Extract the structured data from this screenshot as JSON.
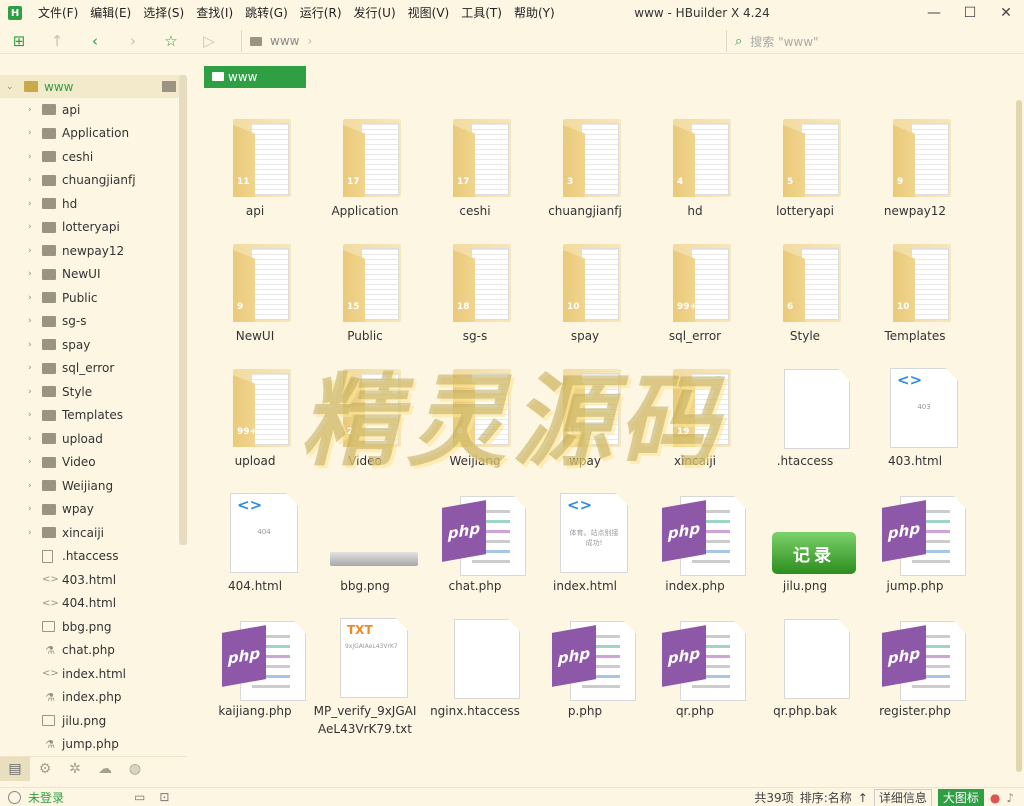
{
  "app": {
    "title": "www - HBuilder X 4.24",
    "logo": "H"
  },
  "menu": [
    "文件(F)",
    "编辑(E)",
    "选择(S)",
    "查找(I)",
    "跳转(G)",
    "运行(R)",
    "发行(U)",
    "视图(V)",
    "工具(T)",
    "帮助(Y)"
  ],
  "window_controls": {
    "minimize": "—",
    "maximize": "☐",
    "close": "✕"
  },
  "toolbar": {
    "breadcrumb": "www",
    "search_placeholder": "搜索 \"www\""
  },
  "tree": {
    "root": "www",
    "items": [
      {
        "name": "api",
        "kind": "folder"
      },
      {
        "name": "Application",
        "kind": "folder"
      },
      {
        "name": "ceshi",
        "kind": "folder"
      },
      {
        "name": "chuangjianfj",
        "kind": "folder"
      },
      {
        "name": "hd",
        "kind": "folder"
      },
      {
        "name": "lotteryapi",
        "kind": "folder"
      },
      {
        "name": "newpay12",
        "kind": "folder"
      },
      {
        "name": "NewUI",
        "kind": "folder"
      },
      {
        "name": "Public",
        "kind": "folder"
      },
      {
        "name": "sg-s",
        "kind": "folder"
      },
      {
        "name": "spay",
        "kind": "folder"
      },
      {
        "name": "sql_error",
        "kind": "folder"
      },
      {
        "name": "Style",
        "kind": "folder"
      },
      {
        "name": "Templates",
        "kind": "folder"
      },
      {
        "name": "upload",
        "kind": "folder"
      },
      {
        "name": "Video",
        "kind": "folder"
      },
      {
        "name": "Weijiang",
        "kind": "folder"
      },
      {
        "name": "wpay",
        "kind": "folder"
      },
      {
        "name": "xincaiji",
        "kind": "folder"
      },
      {
        "name": ".htaccess",
        "kind": "file"
      },
      {
        "name": "403.html",
        "kind": "html"
      },
      {
        "name": "404.html",
        "kind": "html"
      },
      {
        "name": "bbg.png",
        "kind": "image"
      },
      {
        "name": "chat.php",
        "kind": "php"
      },
      {
        "name": "index.html",
        "kind": "html"
      },
      {
        "name": "index.php",
        "kind": "php"
      },
      {
        "name": "jilu.png",
        "kind": "image"
      },
      {
        "name": "jump.php",
        "kind": "php"
      }
    ]
  },
  "main": {
    "path_chip": "www",
    "grid": [
      {
        "name": "api",
        "kind": "folder",
        "count": "11"
      },
      {
        "name": "Application",
        "kind": "folder",
        "count": "17"
      },
      {
        "name": "ceshi",
        "kind": "folder",
        "count": "17"
      },
      {
        "name": "chuangjianfj",
        "kind": "folder",
        "count": "3"
      },
      {
        "name": "hd",
        "kind": "folder",
        "count": "4"
      },
      {
        "name": "lotteryapi",
        "kind": "folder",
        "count": "5"
      },
      {
        "name": "newpay12",
        "kind": "folder",
        "count": "9"
      },
      {
        "name": "NewUI",
        "kind": "folder",
        "count": "9"
      },
      {
        "name": "Public",
        "kind": "folder",
        "count": "15"
      },
      {
        "name": "sg-s",
        "kind": "folder",
        "count": "18"
      },
      {
        "name": "spay",
        "kind": "folder",
        "count": "10"
      },
      {
        "name": "sql_error",
        "kind": "folder",
        "count": "99+"
      },
      {
        "name": "Style",
        "kind": "folder",
        "count": "6"
      },
      {
        "name": "Templates",
        "kind": "folder",
        "count": "10"
      },
      {
        "name": "upload",
        "kind": "folder",
        "count": "99+"
      },
      {
        "name": "Video",
        "kind": "folder",
        "count": "2"
      },
      {
        "name": "Weijiang",
        "kind": "folder",
        "count": "4"
      },
      {
        "name": "wpay",
        "kind": "folder",
        "count": "10"
      },
      {
        "name": "xincaiji",
        "kind": "folder",
        "count": "19"
      },
      {
        "name": ".htaccess",
        "kind": "blank"
      },
      {
        "name": "403.html",
        "kind": "html",
        "preview": "403"
      },
      {
        "name": "404.html",
        "kind": "html",
        "preview": "404"
      },
      {
        "name": "bbg.png",
        "kind": "png-strip"
      },
      {
        "name": "chat.php",
        "kind": "php"
      },
      {
        "name": "index.html",
        "kind": "html",
        "preview": "体育。站点别接成功!"
      },
      {
        "name": "index.php",
        "kind": "php"
      },
      {
        "name": "jilu.png",
        "kind": "png-jilu",
        "preview": "记录"
      },
      {
        "name": "jump.php",
        "kind": "php"
      },
      {
        "name": "kaijiang.php",
        "kind": "php"
      },
      {
        "name": "MP_verify_9xJGAIAeL43VrK79.txt",
        "kind": "txt",
        "preview": "9xJGAIAeL43VrK7",
        "tag": "TXT"
      },
      {
        "name": "nginx.htaccess",
        "kind": "blank"
      },
      {
        "name": "p.php",
        "kind": "php"
      },
      {
        "name": "qr.php",
        "kind": "php"
      },
      {
        "name": "qr.php.bak",
        "kind": "blank"
      },
      {
        "name": "register.php",
        "kind": "php"
      }
    ],
    "php_label": "php",
    "html_tag": "<>"
  },
  "watermark": "精灵源码",
  "status": {
    "user": "未登录",
    "count": "共39项",
    "sort": "排序:名称",
    "sort_arrow": "↑",
    "detail_view": "详细信息",
    "icon_view": "大图标"
  },
  "colors": {
    "accent": "#2ea043",
    "php_badge": "#8e58a8",
    "html_tag": "#2d8ce8",
    "txt_tag": "#f08a24",
    "background": "#fdf6e3"
  }
}
